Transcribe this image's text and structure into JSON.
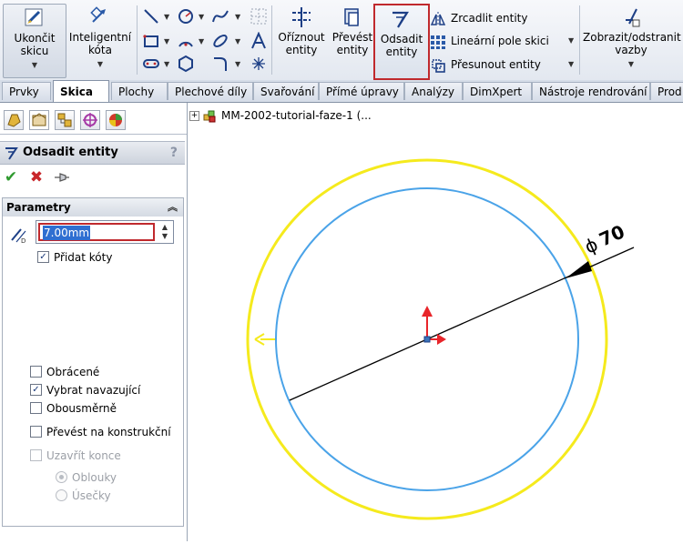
{
  "ribbon": {
    "exit_sketch": "Ukončit\nskicu",
    "smart_dimension": "Inteligentní\nkóta",
    "trim": "Oříznout\nentity",
    "convert": "Převést\nentity",
    "offset": "Odsadit\nentity",
    "mirror": "Zrcadlit entity",
    "linear_pattern": "Lineární pole skici",
    "move": "Přesunout entity",
    "relations": "Zobrazit/odstranit\nvazby"
  },
  "tabs": [
    "Prvky",
    "Skica",
    "Plochy",
    "Plechové díly",
    "Svařování",
    "Přímé úpravy",
    "Analýzy",
    "DimXpert",
    "Nástroje rendrování",
    "Prod"
  ],
  "active_tab": "Skica",
  "property_manager": {
    "title": "Odsadit entity",
    "help": "?",
    "section": "Parametry",
    "offset_value": "7.00mm",
    "options": [
      {
        "label": "Přidat kóty",
        "checked": true,
        "enabled": true
      },
      {
        "label": "Obrácené",
        "checked": false,
        "enabled": true
      },
      {
        "label": "Vybrat navazující",
        "checked": true,
        "enabled": true
      },
      {
        "label": "Obousměrně",
        "checked": false,
        "enabled": true
      },
      {
        "label": "Převést na konstrukční",
        "checked": false,
        "enabled": true
      },
      {
        "label": "Uzavřít konce",
        "checked": false,
        "enabled": false
      }
    ],
    "cap_options": [
      {
        "label": "Oblouky",
        "selected": true
      },
      {
        "label": "Úsečky",
        "selected": false
      }
    ]
  },
  "tree": {
    "root": "MM-2002-tutorial-faze-1  (..."
  },
  "sketch": {
    "dimension_label": "70",
    "colors": {
      "offset_circle": "#f5ea1d",
      "base_circle": "#4aa3e8",
      "dimension": "#000000",
      "origin_x": "#e8252a",
      "origin_y": "#e8252a"
    }
  }
}
